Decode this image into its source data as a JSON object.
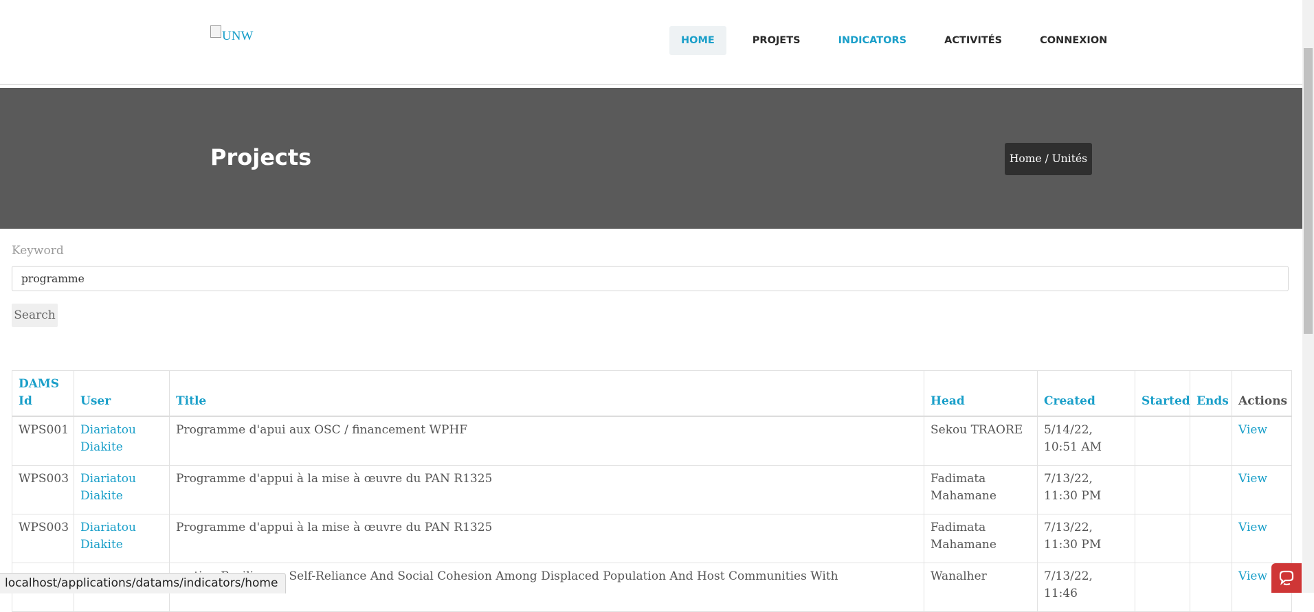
{
  "header": {
    "logo_alt": "UNW",
    "nav": [
      {
        "label": "HOME"
      },
      {
        "label": "PROJETS"
      },
      {
        "label": "INDICATORS"
      },
      {
        "label": "ACTIVITÉS"
      },
      {
        "label": "CONNEXION"
      }
    ]
  },
  "banner": {
    "title": "Projects",
    "breadcrumb_home": "Home",
    "breadcrumb_sep": " / ",
    "breadcrumb_current": "Unités"
  },
  "search": {
    "label": "Keyword",
    "value": "programme",
    "button": "Search"
  },
  "table": {
    "headers": [
      "DAMS Id",
      "User",
      "Title",
      "Head",
      "Created",
      "Started",
      "Ends",
      "Actions"
    ],
    "rows": [
      {
        "id": "WPS001",
        "user": "Diariatou Diakite",
        "title": "Programme d'apui aux OSC / financement WPHF",
        "head": "Sekou TRAORE",
        "created": "5/14/22, 10:51 AM",
        "started": "",
        "ends": "",
        "action": "View"
      },
      {
        "id": "WPS003",
        "user": "Diariatou Diakite",
        "title": "Programme d'appui à la mise à œuvre du PAN R1325",
        "head": "Fadimata Mahamane",
        "created": "7/13/22, 11:30 PM",
        "started": "",
        "ends": "",
        "action": "View"
      },
      {
        "id": "WPS003",
        "user": "Diariatou Diakite",
        "title": "Programme d'appui à la mise à œuvre du PAN R1325",
        "head": "Fadimata Mahamane",
        "created": "7/13/22, 11:30 PM",
        "started": "",
        "ends": "",
        "action": "View"
      },
      {
        "id": "",
        "user": "",
        "title": "motion Resilience, Self-Reliance And Social Cohesion Among Displaced Population And Host Communities With",
        "head": "Wanalher",
        "created": "7/13/22, 11:46",
        "started": "",
        "ends": "",
        "action": "View"
      }
    ]
  },
  "statusbar": {
    "url": "localhost/applications/datams/indicators/home"
  }
}
